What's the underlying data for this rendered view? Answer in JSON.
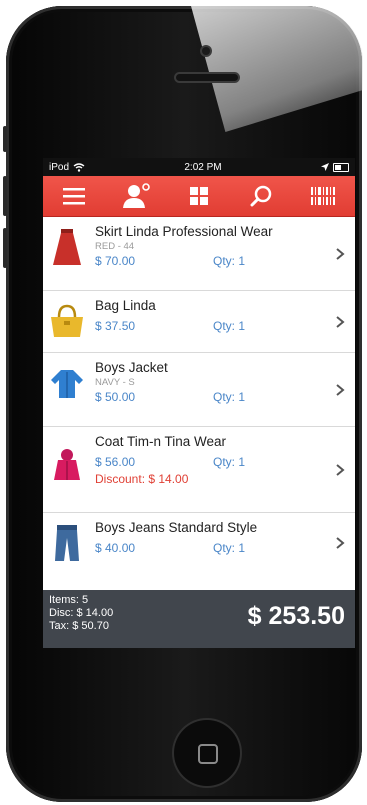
{
  "status_bar": {
    "carrier": "iPod",
    "time": "2:02 PM"
  },
  "toolbar": {
    "icons": [
      "menu-icon",
      "customer-icon",
      "grid-icon",
      "search-icon",
      "barcode-icon"
    ]
  },
  "items": [
    {
      "name": "Skirt Linda Professional Wear",
      "variant": "RED - 44",
      "price": "$ 70.00",
      "qty": "Qty: 1",
      "discount": "",
      "thumb": "skirt-icon"
    },
    {
      "name": "Bag Linda",
      "variant": "",
      "price": "$ 37.50",
      "qty": "Qty: 1",
      "discount": "",
      "thumb": "bag-icon"
    },
    {
      "name": "Boys Jacket",
      "variant": "NAVY - S",
      "price": "$ 50.00",
      "qty": "Qty: 1",
      "discount": "",
      "thumb": "jacket-icon"
    },
    {
      "name": "Coat Tim-n Tina Wear",
      "variant": "",
      "price": "$ 56.00",
      "qty": "Qty: 1",
      "discount": "Discount: $ 14.00",
      "thumb": "coat-icon"
    },
    {
      "name": "Boys Jeans Standard Style",
      "variant": "",
      "price": "$ 40.00",
      "qty": "Qty: 1",
      "discount": "",
      "thumb": "jeans-icon"
    }
  ],
  "summary": {
    "items": "Items: 5",
    "disc": "Disc: $ 14.00",
    "tax": "Tax: $ 50.70",
    "total": "$ 253.50"
  },
  "colors": {
    "accent": "#e8473d",
    "price": "#4a86c8",
    "discount": "#e04035",
    "footer": "#41464d"
  }
}
